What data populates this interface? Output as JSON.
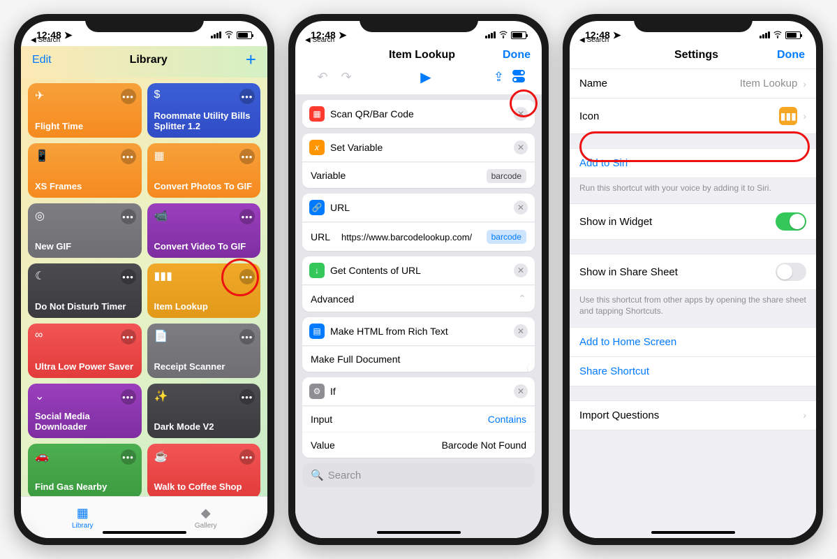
{
  "status": {
    "time": "12:48",
    "back": "Search"
  },
  "phone1": {
    "header": {
      "edit": "Edit",
      "title": "Library",
      "add": "+"
    },
    "cards": [
      {
        "title": "Flight Time",
        "icon": "✈",
        "color": "linear-gradient(#f7a13a,#f58a1f)"
      },
      {
        "title": "Roommate Utility Bills Splitter 1.2",
        "icon": "$",
        "color": "linear-gradient(#3c5fd6,#2f4cc6)"
      },
      {
        "title": "XS Frames",
        "icon": "📱",
        "color": "linear-gradient(#f7a13a,#f58a1f)"
      },
      {
        "title": "Convert Photos To GIF",
        "icon": "▦",
        "color": "linear-gradient(#f7a13a,#f58a1f)"
      },
      {
        "title": "New GIF",
        "icon": "◎",
        "color": "linear-gradient(#7d7d82,#6e6e73)"
      },
      {
        "title": "Convert Video To GIF",
        "icon": "📹",
        "color": "linear-gradient(#9b3fbd,#7e2ea1)"
      },
      {
        "title": "Do Not Disturb Timer",
        "icon": "☾",
        "color": "linear-gradient(#4c4c50,#3b3b3f)"
      },
      {
        "title": "Item Lookup",
        "icon": "▮▮▮",
        "color": "linear-gradient(#f0a928,#e2991a)"
      },
      {
        "title": "Ultra Low Power Saver",
        "icon": "∞",
        "color": "linear-gradient(#f25555,#e23b3b)"
      },
      {
        "title": "Receipt Scanner",
        "icon": "📄",
        "color": "linear-gradient(#7d7d82,#6e6e73)"
      },
      {
        "title": "Social Media Downloader",
        "icon": "⌄",
        "color": "linear-gradient(#9b3fbd,#7e2ea1)"
      },
      {
        "title": "Dark Mode V2",
        "icon": "✨",
        "color": "linear-gradient(#4c4c50,#3b3b3f)"
      },
      {
        "title": "Find Gas Nearby",
        "icon": "🚗",
        "color": "linear-gradient(#4caf50,#3c9b40)"
      },
      {
        "title": "Walk to Coffee Shop",
        "icon": "☕",
        "color": "linear-gradient(#f25555,#e23b3b)"
      }
    ],
    "tabs": {
      "library": "Library",
      "gallery": "Gallery"
    }
  },
  "phone2": {
    "title": "Item Lookup",
    "done": "Done",
    "actions": {
      "scan": "Scan QR/Bar Code",
      "setvar": "Set Variable",
      "var_label": "Variable",
      "var_value": "barcode",
      "url_title": "URL",
      "url_label": "URL",
      "url_value": "https://www.barcodelookup.com/",
      "url_pill": "barcode",
      "getcontents": "Get Contents of URL",
      "advanced": "Advanced",
      "makehtml": "Make HTML from Rich Text",
      "fulldoc": "Make Full Document",
      "if_title": "If",
      "input_label": "Input",
      "input_value": "Contains",
      "value_label": "Value",
      "value_value": "Barcode Not Found"
    },
    "search": "Search"
  },
  "phone3": {
    "title": "Settings",
    "done": "Done",
    "rows": {
      "name_label": "Name",
      "name_value": "Item Lookup",
      "icon_label": "Icon",
      "siri": "Add to Siri",
      "siri_note": "Run this shortcut with your voice by adding it to Siri.",
      "widget": "Show in Widget",
      "sharesheet": "Show in Share Sheet",
      "sharesheet_note": "Use this shortcut from other apps by opening the share sheet and tapping Shortcuts.",
      "homescreen": "Add to Home Screen",
      "share": "Share Shortcut",
      "import": "Import Questions"
    }
  }
}
